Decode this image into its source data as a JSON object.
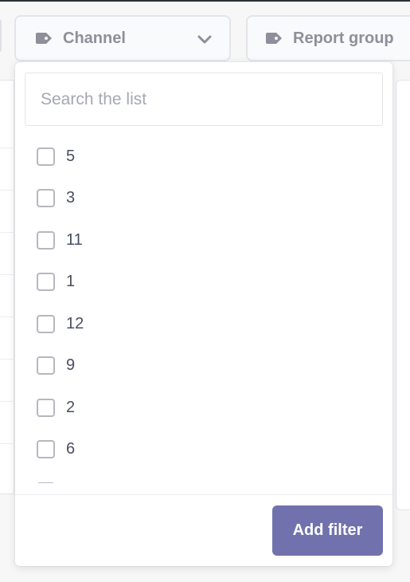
{
  "filters": {
    "channel": {
      "label": "Channel",
      "icon": "tag-icon",
      "dropdown_icon": "chevron-down-icon"
    },
    "report_group": {
      "label": "Report group",
      "icon": "tag-icon"
    }
  },
  "popover": {
    "search": {
      "placeholder": "Search the list",
      "value": ""
    },
    "options": [
      {
        "label": "5",
        "checked": false
      },
      {
        "label": "3",
        "checked": false
      },
      {
        "label": "11",
        "checked": false
      },
      {
        "label": "1",
        "checked": false
      },
      {
        "label": "12",
        "checked": false
      },
      {
        "label": "9",
        "checked": false
      },
      {
        "label": "2",
        "checked": false
      },
      {
        "label": "6",
        "checked": false
      },
      {
        "label": "",
        "checked": false
      }
    ],
    "add_filter_label": "Add filter"
  },
  "colors": {
    "accent": "#7172ad",
    "chip_text": "#8d909b",
    "option_text": "#4a4e60",
    "checkbox_border": "#b6b8c0"
  }
}
